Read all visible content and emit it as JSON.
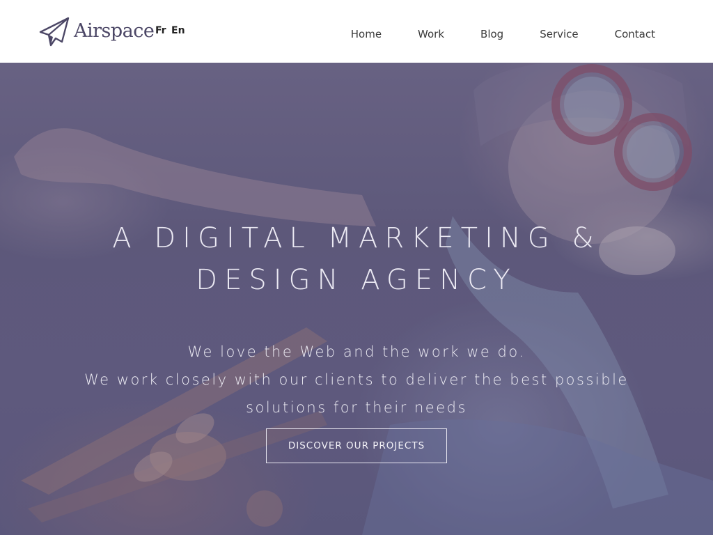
{
  "header": {
    "logo_text": "Airspace",
    "logo_icon": "paper-plane-icon",
    "languages": [
      "Fr",
      "En"
    ],
    "nav": [
      "Home",
      "Work",
      "Blog",
      "Service",
      "Contact"
    ]
  },
  "hero": {
    "headline": [
      "A DIGITAL MARKETING &",
      "DESIGN AGENCY"
    ],
    "tagline": [
      "We love the Web and the work we do.",
      "We work closely with our clients to deliver the best possible",
      "solutions for their needs"
    ],
    "cta_label": "DISCOVER OUR PROJECTS"
  },
  "colors": {
    "brand": "#4c4766",
    "overlay": "#5c5680",
    "hero_text": "#ebe9f3"
  }
}
